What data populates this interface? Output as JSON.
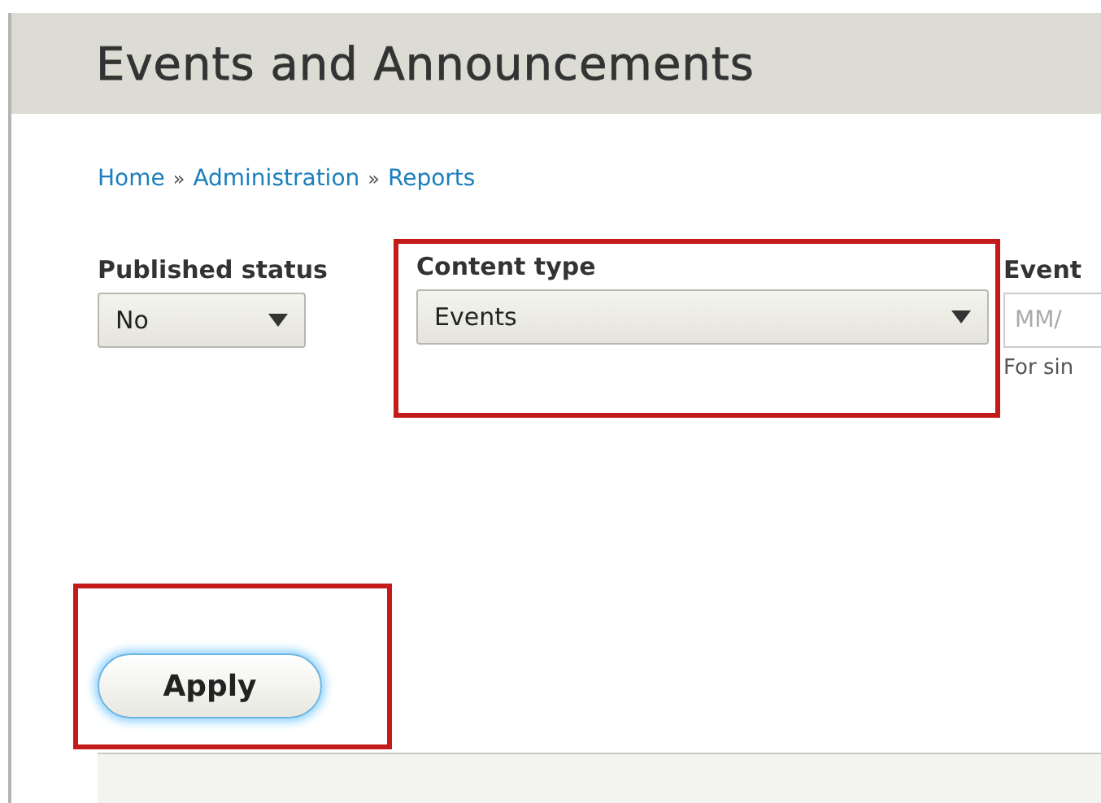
{
  "page_title": "Events and Announcements",
  "breadcrumb": [
    "Home",
    "Administration",
    "Reports"
  ],
  "breadcrumb_separator": "»",
  "filters": [
    {
      "kind": "select",
      "label": "Published status",
      "value": "No",
      "highlighted": false
    },
    {
      "kind": "select",
      "label": "Content type",
      "value": "Events",
      "highlighted": true
    },
    {
      "kind": "date",
      "label": "Event",
      "placeholder": "MM/",
      "description": "For sin",
      "highlighted": false
    }
  ],
  "apply_button": {
    "label": "Apply",
    "highlighted": true
  }
}
